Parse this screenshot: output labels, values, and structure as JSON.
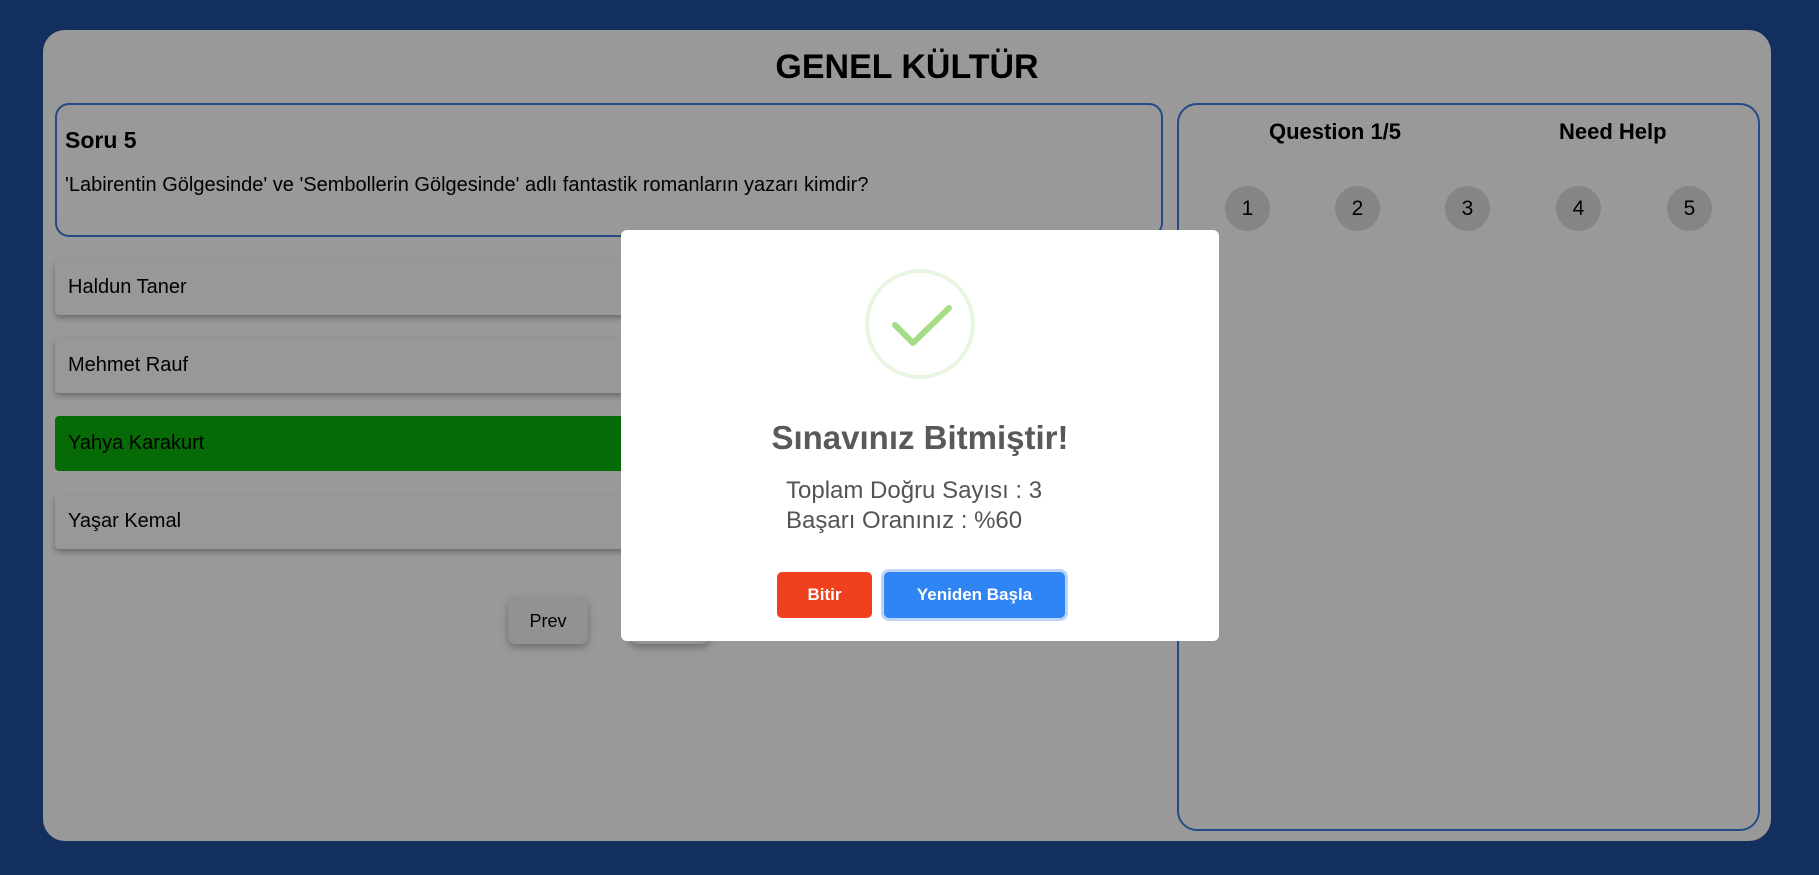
{
  "app": {
    "title": "GENEL KÜLTÜR"
  },
  "question": {
    "number_label": "Soru 5",
    "text": "'Labirentin Gölgesinde' ve 'Sembollerin Gölgesinde' adlı fantastik romanların yazarı kimdir?"
  },
  "options": [
    {
      "label": "Haldun Taner"
    },
    {
      "label": "Mehmet Rauf"
    },
    {
      "label": "Yahya Karakurt",
      "state": "correct"
    },
    {
      "label": "Yaşar Kemal"
    }
  ],
  "navigation": {
    "prev_label": "Prev"
  },
  "side_panel": {
    "question_counter": "Question 1/5",
    "help_label": "Need Help",
    "question_numbers": [
      "1",
      "2",
      "3",
      "4",
      "5"
    ]
  },
  "modal": {
    "icon": "checkmark-icon",
    "title": "Sınavınız Bitmiştir!",
    "correct_count_text": "Toplam Doğru Sayısı : 3",
    "success_rate_text": "Başarı Oranınız : %60",
    "finish_label": "Bitir",
    "restart_label": "Yeniden Başla"
  },
  "colors": {
    "background": "#1f4f9c",
    "accent_border": "#3d7de0",
    "correct_option": "#0ab30a",
    "finish_button": "#f0401e",
    "restart_button": "#3085f5",
    "checkmark": "#a5dc86"
  }
}
